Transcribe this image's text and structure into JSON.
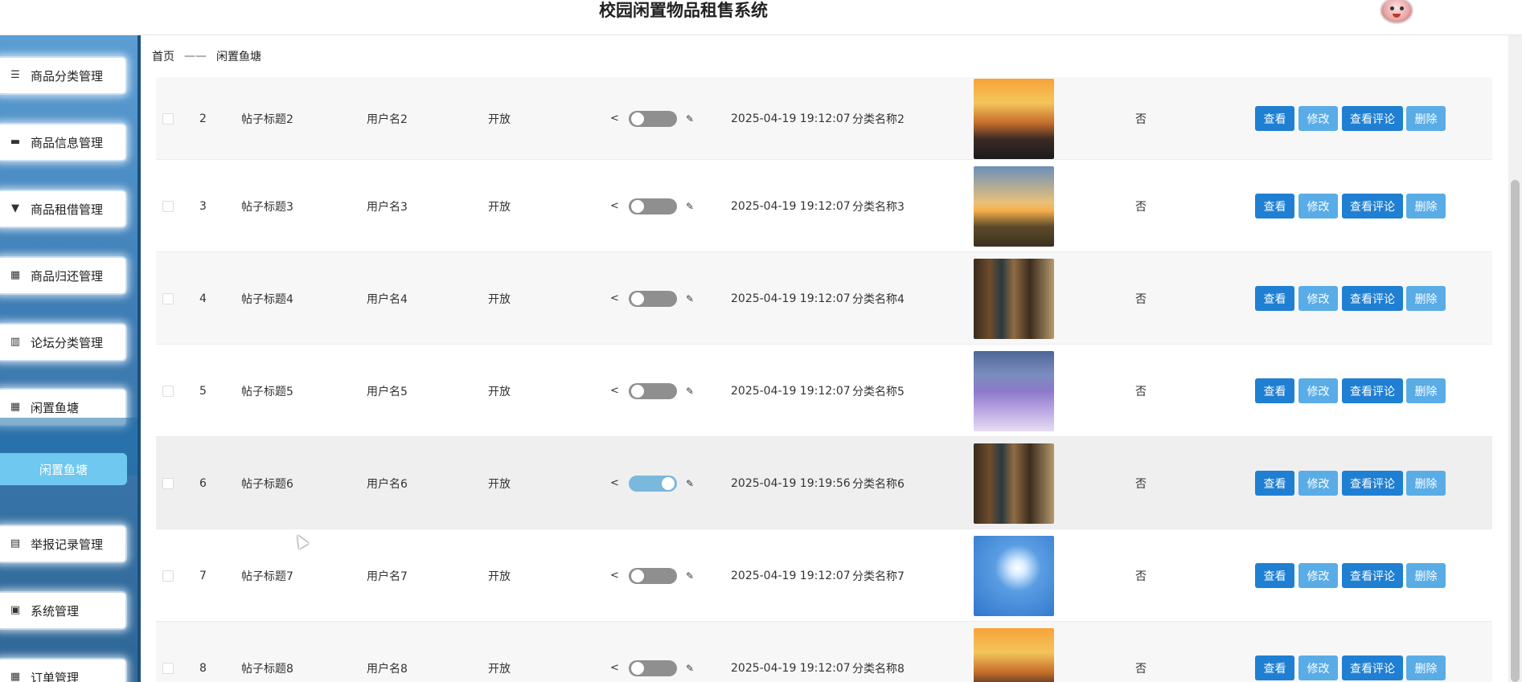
{
  "app_title": "校园闲置物品租售系统",
  "breadcrumb": {
    "home": "首页",
    "sep": "——",
    "current": "闲置鱼塘"
  },
  "sidebar": {
    "items": [
      {
        "label": "商品分类管理",
        "icon": "list-icon"
      },
      {
        "label": "商品信息管理",
        "icon": "monitor-icon"
      },
      {
        "label": "商品租借管理",
        "icon": "pin-icon"
      },
      {
        "label": "商品归还管理",
        "icon": "grid-icon"
      },
      {
        "label": "论坛分类管理",
        "icon": "books-icon"
      },
      {
        "label": "闲置鱼塘",
        "icon": "grid-icon"
      },
      {
        "label": "举报记录管理",
        "icon": "clipboard-icon"
      },
      {
        "label": "系统管理",
        "icon": "briefcase-icon"
      },
      {
        "label": "订单管理",
        "icon": "grid-icon"
      }
    ],
    "active_sub": "闲置鱼塘"
  },
  "actions": {
    "view": "查看",
    "edit": "修改",
    "comments": "查看评论",
    "delete": "删除"
  },
  "rows": [
    {
      "idx": "2",
      "title": "帖子标题2",
      "user": "用户名2",
      "status": "开放",
      "toggle_on": false,
      "time": "2025-04-19 19:12:07",
      "category": "分类名称2",
      "image": "sunset-sea",
      "flag": "否"
    },
    {
      "idx": "3",
      "title": "帖子标题3",
      "user": "用户名3",
      "status": "开放",
      "toggle_on": false,
      "time": "2025-04-19 19:12:07",
      "category": "分类名称3",
      "image": "sunset-grass",
      "flag": "否"
    },
    {
      "idx": "4",
      "title": "帖子标题4",
      "user": "用户名4",
      "status": "开放",
      "toggle_on": false,
      "time": "2025-04-19 19:12:07",
      "category": "分类名称4",
      "image": "library",
      "flag": "否"
    },
    {
      "idx": "5",
      "title": "帖子标题5",
      "user": "用户名5",
      "status": "开放",
      "toggle_on": false,
      "time": "2025-04-19 19:12:07",
      "category": "分类名称5",
      "image": "lavender",
      "flag": "否"
    },
    {
      "idx": "6",
      "title": "帖子标题6",
      "user": "用户名6",
      "status": "开放",
      "toggle_on": true,
      "time": "2025-04-19 19:19:56",
      "category": "分类名称6",
      "image": "library",
      "flag": "否"
    },
    {
      "idx": "7",
      "title": "帖子标题7",
      "user": "用户名7",
      "status": "开放",
      "toggle_on": false,
      "time": "2025-04-19 19:12:07",
      "category": "分类名称7",
      "image": "blue-sky",
      "flag": "否"
    },
    {
      "idx": "8",
      "title": "帖子标题8",
      "user": "用户名8",
      "status": "开放",
      "toggle_on": false,
      "time": "2025-04-19 19:12:07",
      "category": "分类名称8",
      "image": "sunset-sea",
      "flag": "否"
    }
  ]
}
